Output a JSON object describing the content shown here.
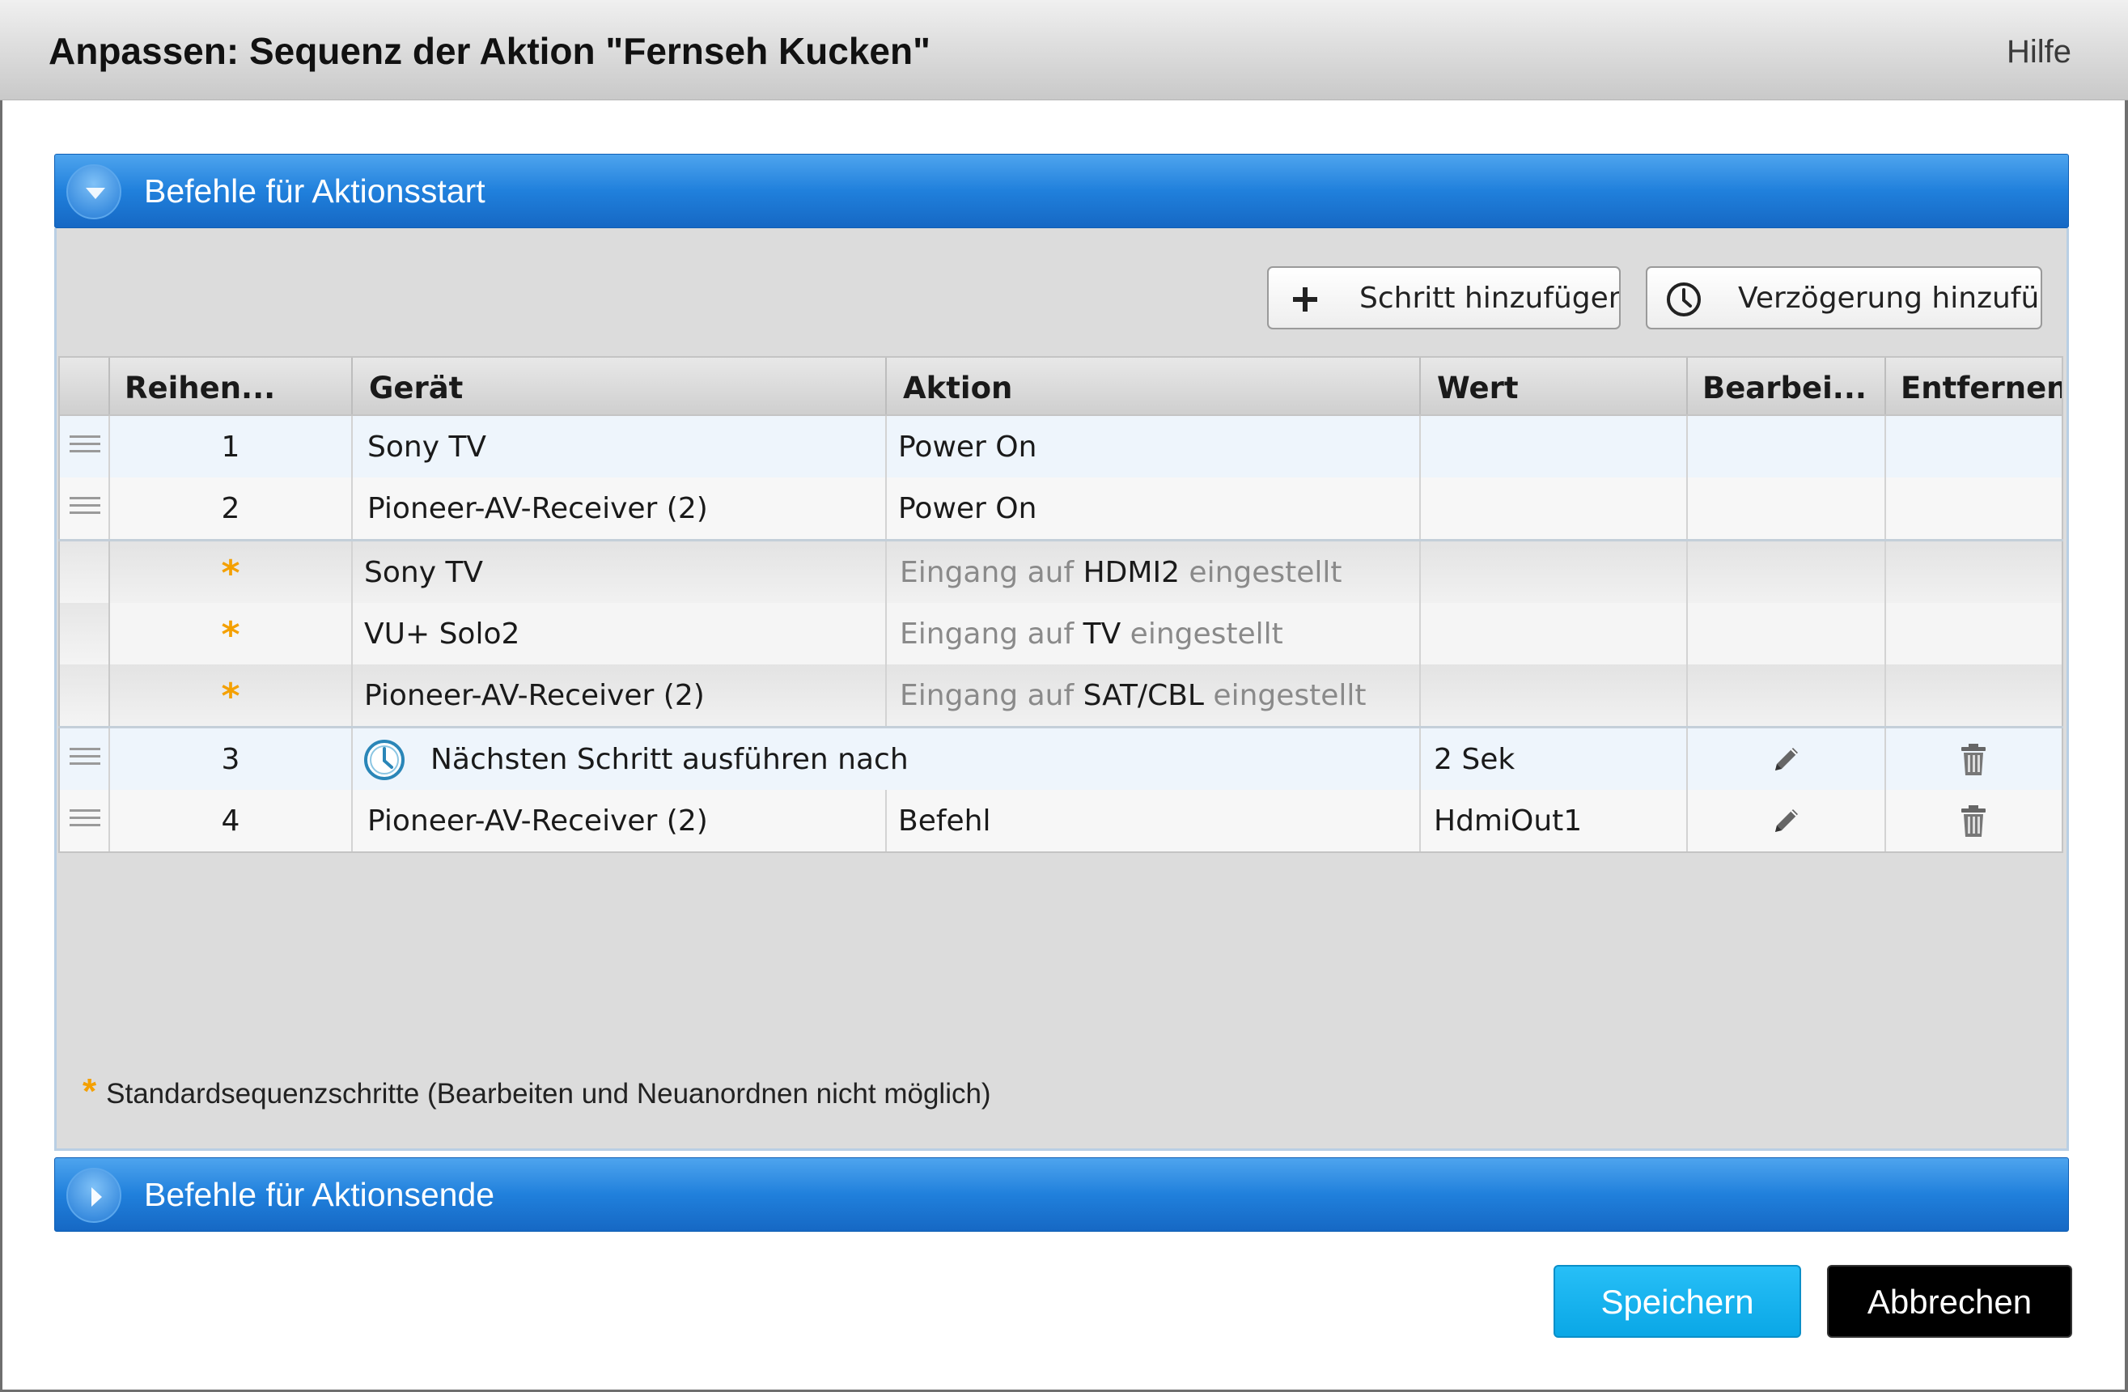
{
  "dialog": {
    "title": "Anpassen: Sequenz der Aktion \"Fernseh Kucken\"",
    "help_label": "Hilfe"
  },
  "section_start": {
    "title": "Befehle für Aktionsstart",
    "toggle_icon": "chevron-down-icon"
  },
  "section_end": {
    "title": "Befehle für Aktionsende",
    "toggle_icon": "chevron-right-icon"
  },
  "toolbar": {
    "add_step_label": "Schritt hinzufügen",
    "add_delay_label": "Verzögerung hinzufüg"
  },
  "table": {
    "headers": [
      "Reihen...",
      "Gerät",
      "Aktion",
      "Wert",
      "Bearbei...",
      "Entfernen"
    ],
    "user_rows_top": [
      {
        "order": "1",
        "device": "Sony TV",
        "action": "Power On",
        "value": ""
      },
      {
        "order": "2",
        "device": "Pioneer-AV-Receiver (2)",
        "action": "Power On",
        "value": ""
      }
    ],
    "standard_rows": [
      {
        "marker": "*",
        "device": "Sony TV",
        "action_prefix": "Eingang auf",
        "action_value": "HDMI2",
        "action_suffix": "eingestellt"
      },
      {
        "marker": "*",
        "device": "VU+ Solo2",
        "action_prefix": "Eingang auf",
        "action_value": "TV",
        "action_suffix": "eingestellt"
      },
      {
        "marker": "*",
        "device": "Pioneer-AV-Receiver (2)",
        "action_prefix": "Eingang auf",
        "action_value": "SAT/CBL",
        "action_suffix": "eingestellt"
      }
    ],
    "user_rows_bottom": [
      {
        "order": "3",
        "description": "Nächsten Schritt ausführen nach",
        "value": "2 Sek"
      },
      {
        "order": "4",
        "device": "Pioneer-AV-Receiver (2)",
        "action": "Befehl",
        "value": "HdmiOut1"
      }
    ]
  },
  "legend": {
    "marker": "*",
    "text": "Standardsequenzschritte (Bearbeiten und Neuanordnen nicht möglich)"
  },
  "footer": {
    "save_label": "Speichern",
    "cancel_label": "Abbrechen"
  },
  "colors": {
    "accent_blue": "#2080dc",
    "save_button": "#0aa7e6",
    "standard_marker": "#f4a000"
  }
}
